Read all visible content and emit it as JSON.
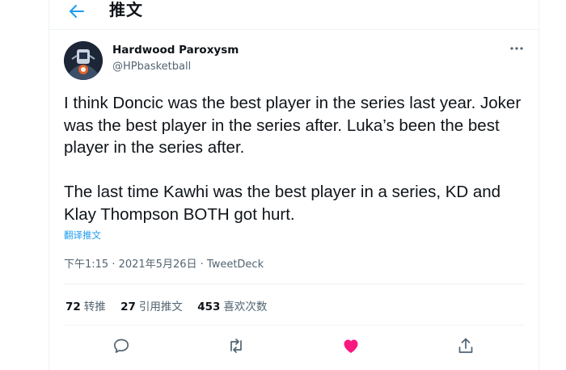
{
  "header": {
    "title": "推文"
  },
  "tweet": {
    "author_name": "Hardwood Paroxysm",
    "author_handle": "@HPbasketball",
    "paragraph1": "I think Doncic was the best player in the series last year. Joker was the best player in the series after. Luka’s been the best player in the series after.",
    "paragraph2": "The last time Kawhi was the best player in a series, KD and Klay Thompson BOTH got hurt.",
    "translate_label": "翻译推文",
    "timestamp": "下午1:15 · 2021年5月26日",
    "separator": " · ",
    "source": "TweetDeck"
  },
  "stats": {
    "retweets_count": "72",
    "retweets_label": "转推",
    "quotes_count": "27",
    "quotes_label": "引用推文",
    "likes_count": "453",
    "likes_label": "喜欢次数"
  },
  "colors": {
    "accent": "#1d9bf0",
    "like": "#f91880",
    "secondary_text": "#536471"
  },
  "icons": [
    "back-arrow-icon",
    "more-icon",
    "reply-icon",
    "retweet-icon",
    "like-icon",
    "share-icon"
  ]
}
